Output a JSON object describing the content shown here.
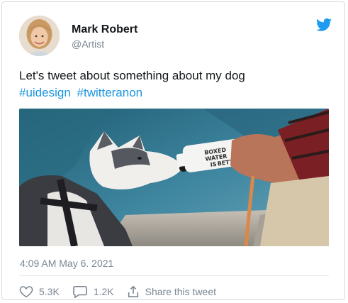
{
  "tweet": {
    "author_name": "Mark Robert",
    "handle": "@Artist",
    "text": "Let's tweet about something about my dog",
    "hashtags": [
      "#uidesign",
      "#twitteranon"
    ],
    "timestamp": "4:09 AM May 6. 2021",
    "bottle_text": [
      "BOXED",
      "WATER",
      "IS",
      "BETTER."
    ]
  },
  "actions": {
    "likes": "5.3K",
    "replies": "1.2K",
    "share_label": "Share this tweet"
  },
  "icons": {
    "bird": "twitter-bird-icon",
    "like": "heart-icon",
    "reply": "speech-bubble-icon",
    "share": "share-icon"
  },
  "colors": {
    "accent": "#1b95e0",
    "muted": "#7a8691",
    "text": "#14171a"
  }
}
